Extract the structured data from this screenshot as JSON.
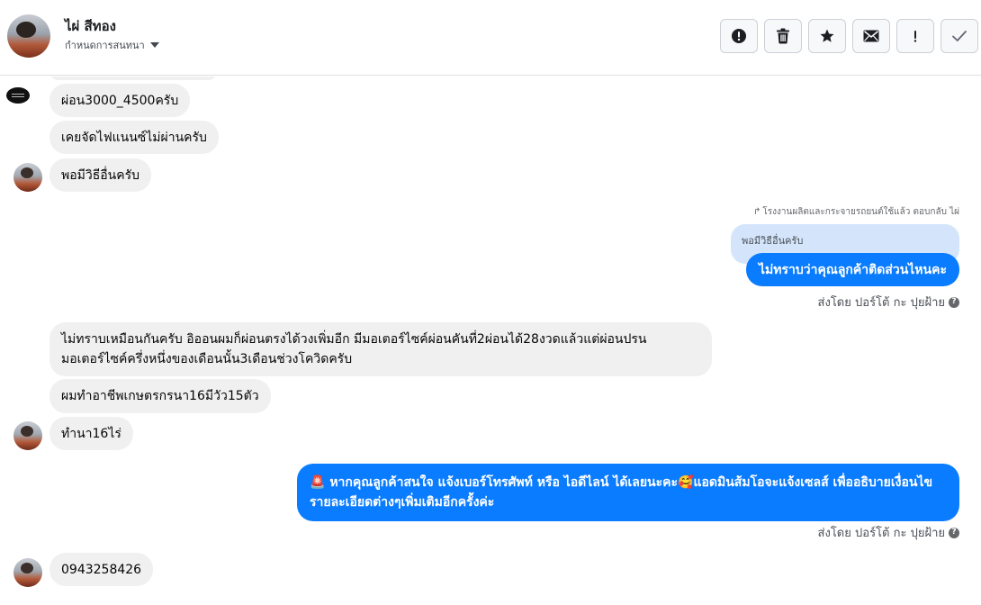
{
  "header": {
    "contact_name": "ไผ่ สีทอง",
    "assign_label": "กำหนดการสนทนา",
    "actions": [
      {
        "icon": "alert-circle-icon"
      },
      {
        "icon": "trash-icon"
      },
      {
        "icon": "star-icon"
      },
      {
        "icon": "envelope-icon"
      },
      {
        "icon": "exclamation-icon"
      },
      {
        "icon": "checkmark-icon"
      }
    ]
  },
  "messages": {
    "m1": "ผ่อน3000_4500ครับ",
    "m2": "เคยจัดไฟแนนซ์ไม่ผ่านครับ",
    "m3": "พอมีวิธีอื่นครับ",
    "reply_note": "โรงงานผลิตและกระจายรถยนต์ใช้แล้ว ตอบกลับ ไผ่",
    "quoted": "พอมีวิธีอื่นครับ",
    "out1": "ไม่ทราบว่าคุณลูกค้าติดส่วนไหนคะ",
    "sent_by_1": "ส่งโดย ปอร์โต้ กะ ปุยฝ้าย",
    "m4": "ไม่ทราบเหมือนกันครับ อิออนผมก็ผ่อนตรงได้วงเพิ่มอีก มีมอเตอร์ไซค์ผ่อนคันที่2ผ่อนได้28งวดแล้วแต่ผ่อนปรนมอเตอร์ไซค์ครึ่งหนึ่งของเดือนนั้น3เดือนช่วงโควิดครับ",
    "m5": "ผมทำอาชีพเกษตรกรนา16มีวัว15ตัว",
    "m6": "ทำนา16ไร่",
    "out2_emoji_start": "🚨",
    "out2_text_a": "หากคุณลูกค้าสนใจ แจ้งเบอร์โทรศัพท์ หรือ ไอดีไลน์  ได้เลยนะคะ",
    "out2_emoji_mid": "🥰",
    "out2_text_b": "แอดมินส้มโอจะแจ้งเซลส์   เพื่ออธิบายเงื่อนไขรายละเอียดต่างๆเพิ่มเติมอีกครั้งค่ะ",
    "sent_by_2": "ส่งโดย ปอร์โต้ กะ ปุยฝ้าย",
    "m7": "0943258426",
    "help": "?"
  },
  "colors": {
    "outgoing_bubble": "#0a7cff",
    "incoming_bubble": "#f0f0f0",
    "quoted_bubble": "#d4e5fb"
  }
}
